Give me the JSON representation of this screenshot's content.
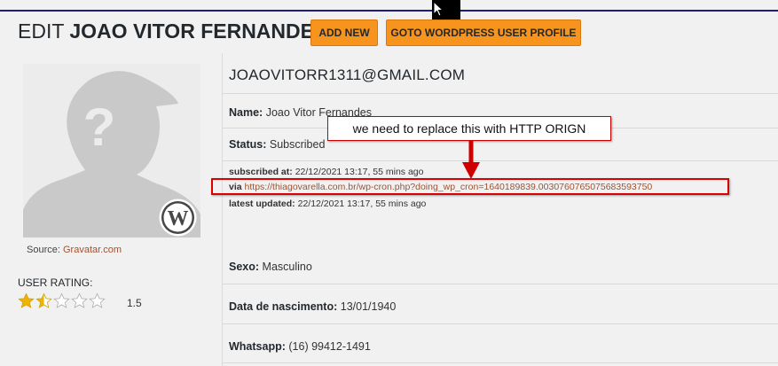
{
  "header": {
    "title_prefix": "EDIT",
    "title_name": "JOAO VITOR FERNANDES",
    "add_new_label": "ADD NEW",
    "goto_wp_label": "GOTO WORDPRESS USER PROFILE"
  },
  "avatar": {
    "source_label": "Source:",
    "source_link": "Gravatar.com"
  },
  "rating": {
    "label": "USER RATING:",
    "value": "1.5",
    "stars_filled": 1.5,
    "stars_total": 5
  },
  "profile": {
    "email": "JOAOVITORR1311@GMAIL.COM",
    "name_label": "Name:",
    "name_value": "Joao Vitor Fernandes",
    "status_label": "Status:",
    "status_value": "Subscribed",
    "subscribed_at_label": "subscribed at:",
    "subscribed_at_value": "22/12/2021 13:17, 55 mins ago",
    "via_label": "via",
    "via_url": "https://thiagovarella.com.br/wp-cron.php?doing_wp_cron=1640189839.0030760765075683593750",
    "latest_updated_label": "latest updated:",
    "latest_updated_value": "22/12/2021 13:17, 55 mins ago",
    "sexo_label": "Sexo:",
    "sexo_value": "Masculino",
    "nascimento_label": "Data de nascimento:",
    "nascimento_value": "13/01/1940",
    "whatsapp_label": "Whatsapp:",
    "whatsapp_value": "(16) 99412-1491"
  },
  "annotation": {
    "callout_text": "we need to replace this with HTTP ORIGN"
  },
  "colors": {
    "accent_button": "#f7941d",
    "link": "#a0522d",
    "annotation_red": "#d00000",
    "star_gold": "#f0b400"
  }
}
